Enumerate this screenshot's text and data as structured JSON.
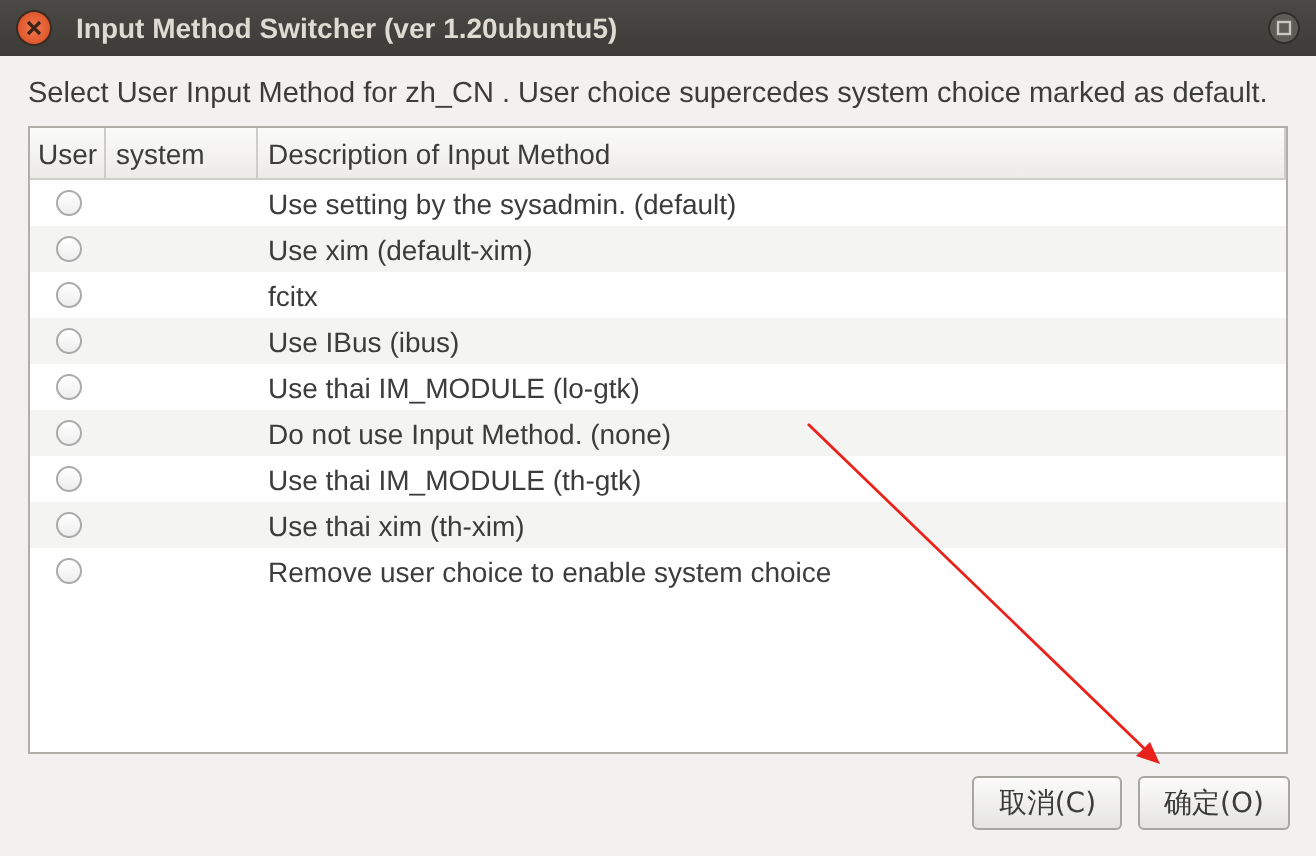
{
  "window": {
    "title": "Input Method Switcher (ver 1.20ubuntu5)"
  },
  "instruction": "Select User Input Method for zh_CN . User choice supercedes system choice marked as default.",
  "table": {
    "columns": [
      "User",
      "system",
      "Description of Input Method"
    ],
    "rows": [
      {
        "user_selected": false,
        "description": "Use setting by the sysadmin. (default)"
      },
      {
        "user_selected": false,
        "description": "Use xim (default-xim)"
      },
      {
        "user_selected": false,
        "description": "fcitx"
      },
      {
        "user_selected": false,
        "description": "Use IBus (ibus)"
      },
      {
        "user_selected": false,
        "description": "Use thai IM_MODULE (lo-gtk)"
      },
      {
        "user_selected": false,
        "description": "Do not use Input Method. (none)"
      },
      {
        "user_selected": false,
        "description": "Use thai IM_MODULE (th-gtk)"
      },
      {
        "user_selected": false,
        "description": "Use thai xim (th-xim)"
      },
      {
        "user_selected": false,
        "description": "Remove user choice to enable system choice"
      }
    ]
  },
  "buttons": [
    "取消(C)",
    "确定(O)"
  ]
}
